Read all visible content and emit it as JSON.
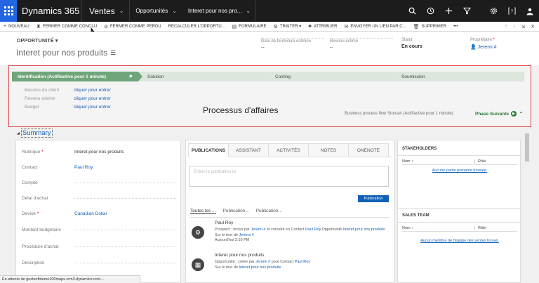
{
  "app": {
    "brand": "Dynamics 365",
    "module": "Ventes",
    "breadcrumb": [
      "Opportunités",
      "Interet pour nos pro..."
    ]
  },
  "commands": [
    {
      "icon": "+",
      "label": "NOUVEAU"
    },
    {
      "icon": "♜",
      "label": "FERMER COMME CONCLU"
    },
    {
      "icon": "⊘",
      "label": "FERMER COMME PERDU"
    },
    {
      "icon": "",
      "label": "RECALCULER L'OPPORTU..."
    },
    {
      "icon": "▤",
      "label": "FORMULAIRE"
    },
    {
      "icon": "⚙",
      "label": "TRAITER ▾"
    },
    {
      "icon": "♣",
      "label": "ATTRIBUER"
    },
    {
      "icon": "✉",
      "label": "ENVOYER UN LIEN PAR C..."
    },
    {
      "icon": "🗑",
      "label": "SUPPRIMER"
    },
    {
      "icon": "",
      "label": "•••"
    }
  ],
  "header": {
    "entity": "OPPORTUNITÉ ▾",
    "title": "Interet pour nos produits",
    "fields": {
      "close_date": {
        "label": "Date de fermeture estimée",
        "value": "--"
      },
      "revenue": {
        "label": "Revenu estimé",
        "value": "--"
      },
      "status": {
        "label": "Statut",
        "value": "En cours"
      },
      "owner": {
        "label": "Propriétaire",
        "value": "Jeremi #"
      }
    }
  },
  "bpf": {
    "stages": [
      "Identification (Actif/active pour 1 minute)",
      "Solution",
      "Costing",
      "Soumission"
    ],
    "fields": [
      {
        "label": "Besoins du client",
        "value": "cliquer pour entrer"
      },
      {
        "label": "Revenu estimé",
        "value": "cliquer pour entrer"
      },
      {
        "label": "Budget",
        "value": "cliquer pour entrer"
      }
    ],
    "annotation": "Processus d'affaires",
    "status": "Business process flow Storcan (Actif/active pour 1 minute)",
    "next": "Phase Suivante"
  },
  "summary": {
    "title": "Summary",
    "fields": [
      {
        "label": "Rubrique",
        "value": "Interet pour nos produits",
        "required": true,
        "link": false
      },
      {
        "label": "Contact",
        "value": "Paul Roy",
        "required": false,
        "link": true
      },
      {
        "label": "Compte",
        "value": "",
        "required": false,
        "link": false
      },
      {
        "label": "Délai d'achat",
        "value": "",
        "required": false,
        "link": false
      },
      {
        "label": "Devise",
        "value": "Canadian Dollar",
        "required": true,
        "link": true
      },
      {
        "label": "Montant budgétaire",
        "value": "",
        "required": false,
        "link": false
      },
      {
        "label": "Procédure d'achat",
        "value": "",
        "required": false,
        "link": false
      },
      {
        "label": "Description",
        "value": "",
        "required": false,
        "link": false
      }
    ]
  },
  "social": {
    "tabs": [
      "PUBLICATIONS",
      "ASSISTANT",
      "ACTIVITÉS",
      "NOTES",
      "ONENOTE"
    ],
    "placeholder": "Entrer la publication ici",
    "publish": "Publication",
    "subtabs": [
      "Toutes les ...",
      "Publication...",
      "Publication..."
    ],
    "posts": [
      {
        "author": "Paul Roy",
        "line1_a": "Prospect : inclus par ",
        "line1_b": "Jeremi #",
        "line1_c": " et converti en Contact ",
        "line1_d": "Paul Roy",
        "line1_e": ",Opportunité ",
        "line1_f": "Interet pour nos produits",
        "wall_prefix": "Sur le mur de ",
        "wall": "Jeremi #",
        "time": "Aujourd'hui 3:10 PM"
      },
      {
        "author": "Interet pour nos produits",
        "line1_a": "Opportunité : créée par ",
        "line1_b": "Jeremi #",
        "line1_c": " pour Contact ",
        "line1_d": "Paul Roy",
        "wall_prefix": "Sur le mur de ",
        "wall": "Interet pour nos produits"
      }
    ]
  },
  "stakeholders": {
    "title": "STAKEHOLDERS",
    "col1": "Nom ↑",
    "col2": "Rôle",
    "empty": "Aucune partie prenante trouvée."
  },
  "sales_team": {
    "title": "SALES TEAM",
    "col1": "Nom ↑",
    "col2": "Rôle",
    "empty": "Aucun membre de l'équipe des ventes trouvé."
  },
  "statusbar": "En attente de gestsoftdemo100maps.crm3.dynamics.com..."
}
